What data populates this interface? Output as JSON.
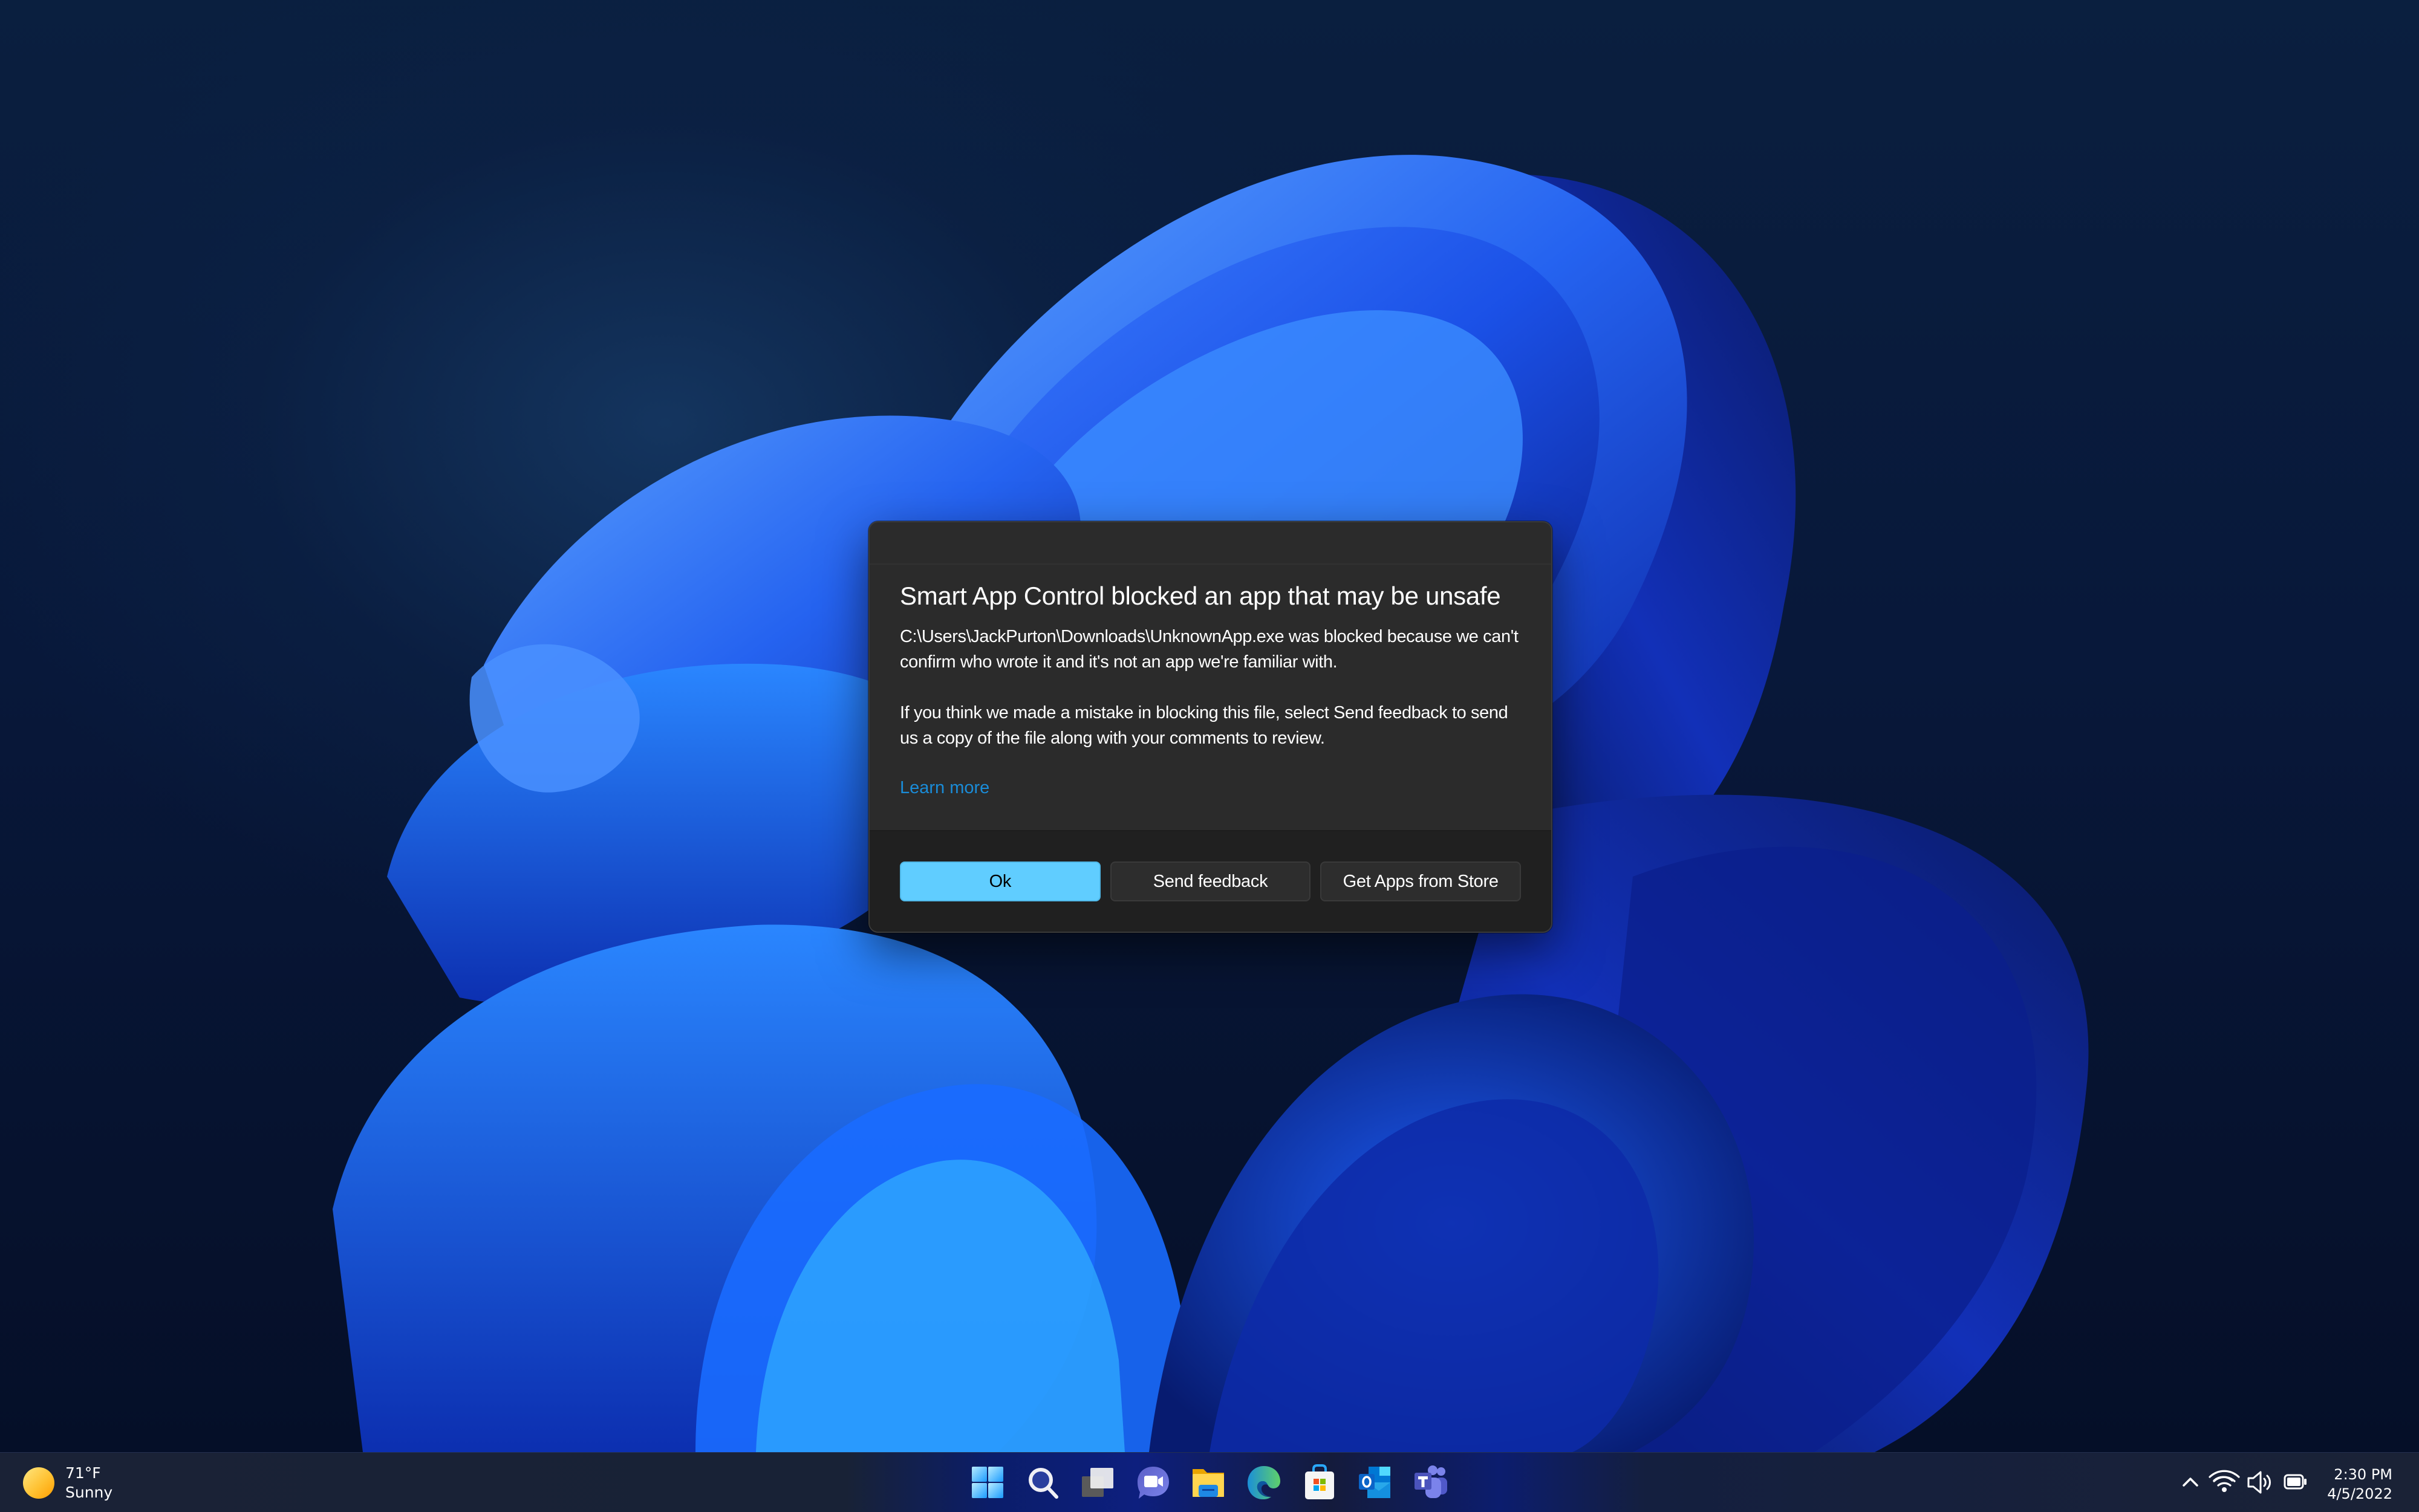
{
  "dialog": {
    "title": "Smart App Control blocked an app that may be unsafe",
    "paragraph1": "C:\\Users\\JackPurton\\Downloads\\UnknownApp.exe was blocked because we can't confirm who wrote it and it's not an app we're familiar with.",
    "paragraph2": "If you think we made a mistake in blocking this file, select Send feedback to send us a copy of the file along with your comments to review.",
    "learn_more": "Learn more",
    "buttons": {
      "ok": "Ok",
      "send_feedback": "Send feedback",
      "get_apps": "Get Apps from Store"
    },
    "colors": {
      "accent": "#60cdff",
      "link": "#1a8cd8",
      "background": "#2b2b2b",
      "footer": "#202020"
    }
  },
  "taskbar": {
    "weather": {
      "icon": "sun-icon",
      "temperature": "71°F",
      "condition": "Sunny"
    },
    "pinned": [
      {
        "name": "Start",
        "icon": "windows-start-icon"
      },
      {
        "name": "Search",
        "icon": "search-icon"
      },
      {
        "name": "Task View",
        "icon": "task-view-icon"
      },
      {
        "name": "Chat",
        "icon": "chat-icon"
      },
      {
        "name": "File Explorer",
        "icon": "file-explorer-icon"
      },
      {
        "name": "Microsoft Edge",
        "icon": "edge-icon"
      },
      {
        "name": "Microsoft Store",
        "icon": "store-icon"
      },
      {
        "name": "Outlook",
        "icon": "outlook-icon"
      },
      {
        "name": "Teams",
        "icon": "teams-icon"
      }
    ],
    "tray": {
      "overflow_icon": "chevron-up-icon",
      "status_icons": [
        "wifi-icon",
        "volume-icon",
        "battery-icon"
      ],
      "time": "2:30 PM",
      "date": "4/5/2022"
    }
  }
}
